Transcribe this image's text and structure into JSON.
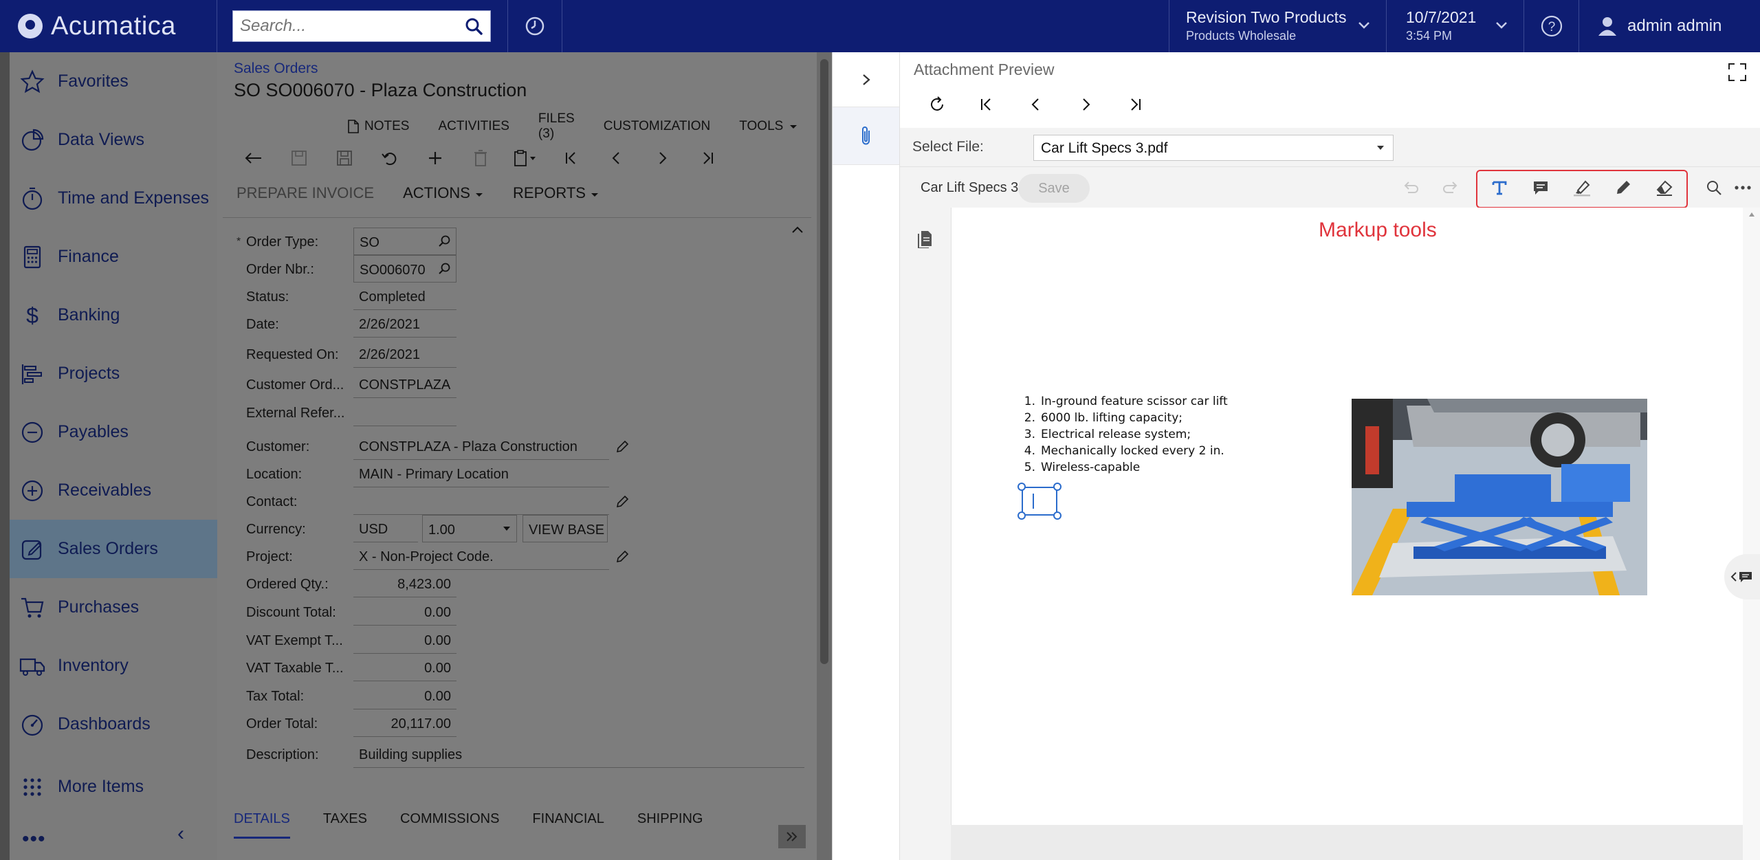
{
  "topbar": {
    "logo_text": "Acumatica",
    "search_placeholder": "Search...",
    "company_name": "Revision Two Products",
    "company_branch": "Products Wholesale",
    "date": "10/7/2021",
    "time": "3:54 PM",
    "user_name": "admin admin"
  },
  "sidebar": {
    "items": [
      {
        "label": "Favorites",
        "icon": "star-icon"
      },
      {
        "label": "Data Views",
        "icon": "pie-chart-icon"
      },
      {
        "label": "Time and Expenses",
        "icon": "stopwatch-icon"
      },
      {
        "label": "Finance",
        "icon": "calculator-icon"
      },
      {
        "label": "Banking",
        "icon": "dollar-icon"
      },
      {
        "label": "Projects",
        "icon": "gantt-icon"
      },
      {
        "label": "Payables",
        "icon": "minus-circle-icon"
      },
      {
        "label": "Receivables",
        "icon": "plus-circle-icon"
      },
      {
        "label": "Sales Orders",
        "icon": "edit-square-icon"
      },
      {
        "label": "Purchases",
        "icon": "cart-icon"
      },
      {
        "label": "Inventory",
        "icon": "truck-icon"
      },
      {
        "label": "Dashboards",
        "icon": "gauge-icon"
      },
      {
        "label": "More Items",
        "icon": "grid-dots-icon"
      }
    ],
    "active": "Sales Orders",
    "more_dots": "•••",
    "collapse": "‹"
  },
  "form": {
    "breadcrumb": "Sales Orders",
    "title": "SO SO006070 - Plaza Construction",
    "links": [
      "NOTES",
      "ACTIVITIES",
      "FILES (3)",
      "CUSTOMIZATION",
      "TOOLS"
    ],
    "actions": {
      "prepare_invoice": "PREPARE INVOICE",
      "actions": "ACTIONS",
      "reports": "REPORTS"
    },
    "fields": {
      "order_type": {
        "label": "Order Type:",
        "value": "SO"
      },
      "order_nbr": {
        "label": "Order Nbr.:",
        "value": "SO006070"
      },
      "status": {
        "label": "Status:",
        "value": "Completed"
      },
      "date": {
        "label": "Date:",
        "value": "2/26/2021"
      },
      "requested_on": {
        "label": "Requested On:",
        "value": "2/26/2021"
      },
      "customer_ord": {
        "label": "Customer Ord...",
        "value": "CONSTPLAZA"
      },
      "external_ref": {
        "label": "External Refer...",
        "value": ""
      },
      "customer": {
        "label": "Customer:",
        "value": "CONSTPLAZA - Plaza Construction"
      },
      "location": {
        "label": "Location:",
        "value": "MAIN - Primary Location"
      },
      "contact": {
        "label": "Contact:",
        "value": ""
      },
      "currency": {
        "label": "Currency:",
        "value": "USD",
        "rate": "1.00",
        "view_base": "VIEW BASE"
      },
      "project": {
        "label": "Project:",
        "value": "X - Non-Project Code."
      },
      "ordered_qty": {
        "label": "Ordered Qty.:",
        "value": "8,423.00"
      },
      "discount_total": {
        "label": "Discount Total:",
        "value": "0.00"
      },
      "vat_exempt": {
        "label": "VAT Exempt T...",
        "value": "0.00"
      },
      "vat_taxable": {
        "label": "VAT Taxable T...",
        "value": "0.00"
      },
      "tax_total": {
        "label": "Tax Total:",
        "value": "0.00"
      },
      "order_total": {
        "label": "Order Total:",
        "value": "20,117.00"
      },
      "description": {
        "label": "Description:",
        "value": "Building supplies"
      }
    },
    "tabs": [
      "DETAILS",
      "TAXES",
      "COMMISSIONS",
      "FINANCIAL",
      "SHIPPING"
    ]
  },
  "preview": {
    "title": "Attachment Preview",
    "select_file_label": "Select File:",
    "selected_file": "Car Lift Specs 3.pdf",
    "doc_name": "Car Lift Specs 3",
    "save_label": "Save",
    "markup_callout": "Markup tools",
    "document_list": [
      {
        "n": "1.",
        "text": "In-ground feature scissor car lift"
      },
      {
        "n": "2.",
        "text": "6000 lb. lifting capacity;"
      },
      {
        "n": "3.",
        "text": "Electrical release system;"
      },
      {
        "n": "4.",
        "text": "Mechanically locked every 2 in."
      },
      {
        "n": "5.",
        "text": "Wireless-capable"
      }
    ],
    "colors": {
      "highlight": "#e0343c",
      "accent": "#2b6ccc",
      "topbar": "#0e1d72"
    }
  }
}
